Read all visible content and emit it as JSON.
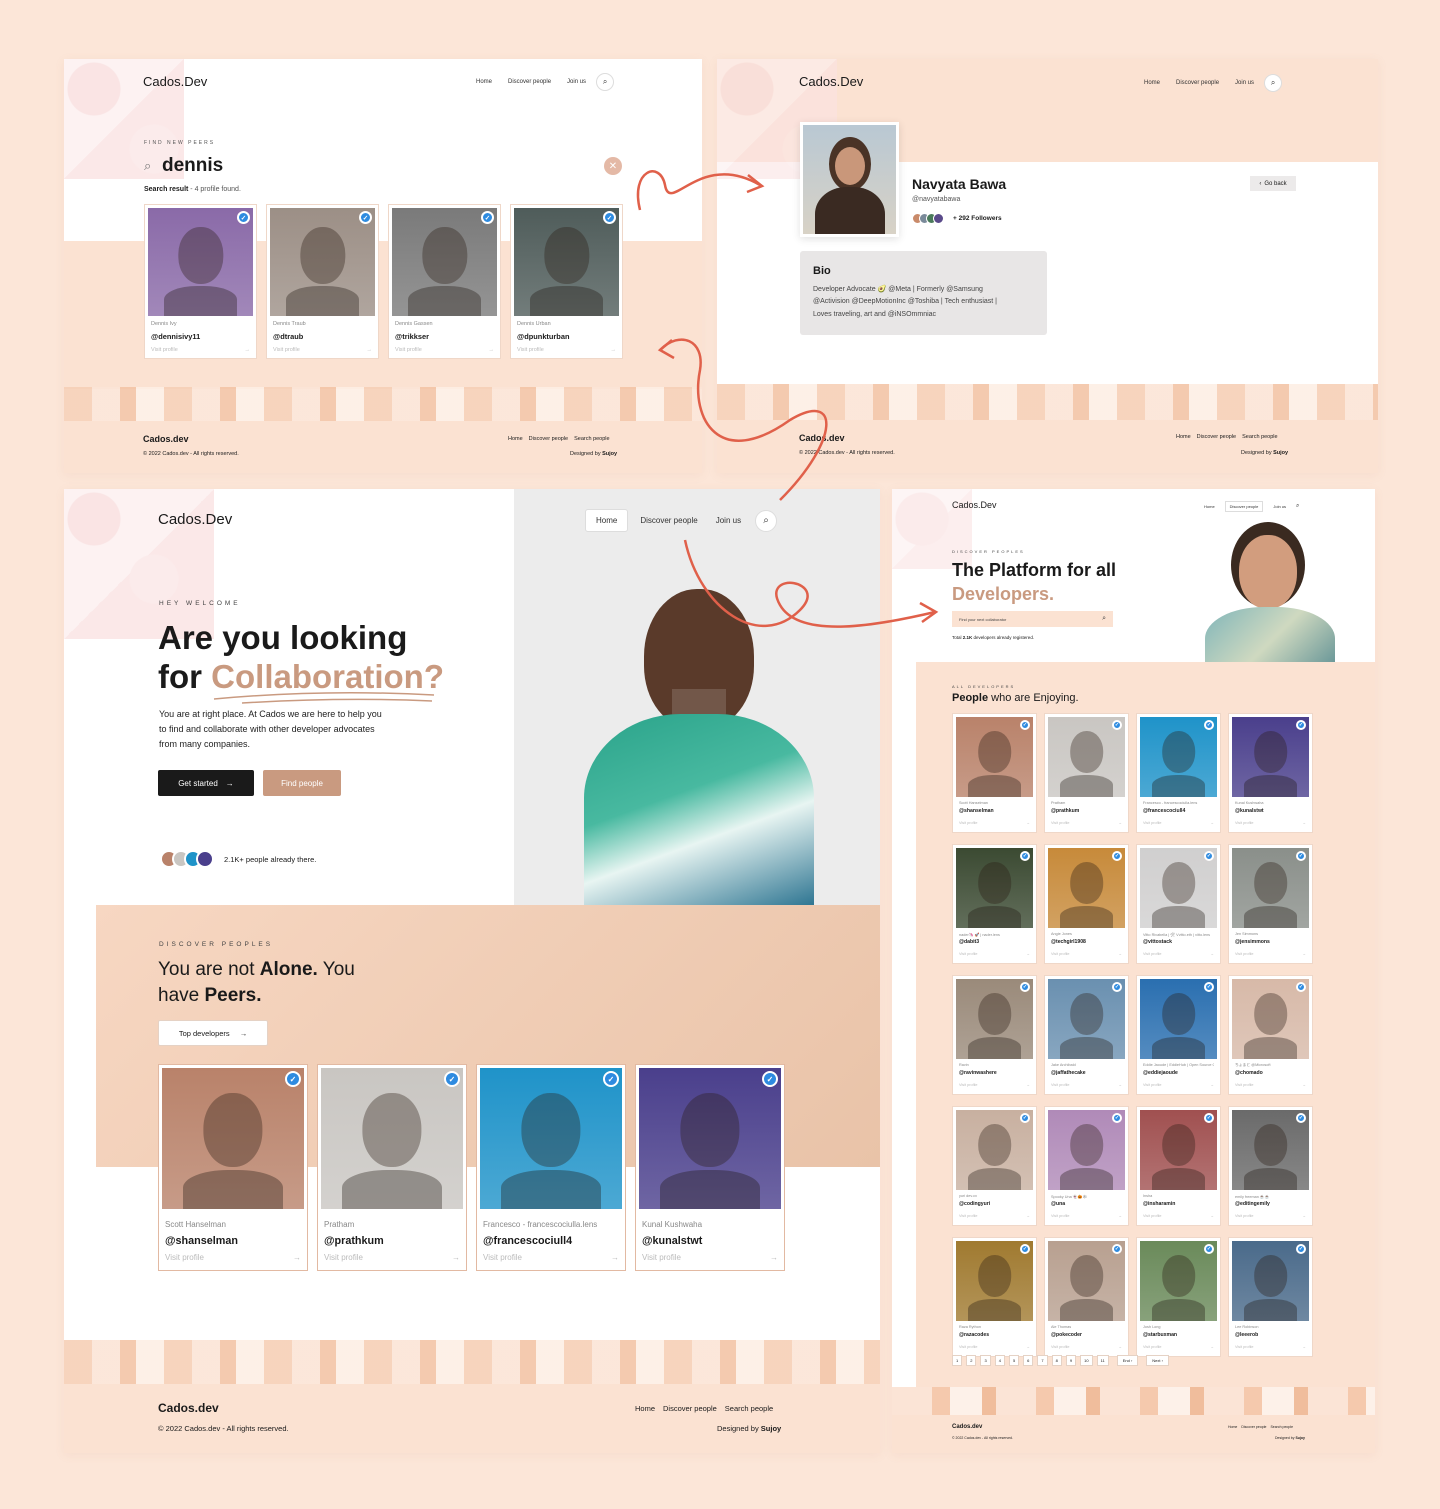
{
  "brand": "Cados.Dev",
  "footer_brand": "Cados.dev",
  "nav": {
    "home": "Home",
    "discover": "Discover people",
    "join": "Join us"
  },
  "footer": {
    "copyright": "© 2022 Cados.dev - All rights reserved.",
    "links": [
      "Home",
      "Discover people",
      "Search people"
    ],
    "designed_prefix": "Designed by",
    "designed_name": "Sujoy"
  },
  "search": {
    "eyebrow": "FIND NEW PEERS",
    "query": "dennis",
    "result_prefix": "Search result",
    "result_count": " - 4 profile found.",
    "cards": [
      {
        "name": "Dennis Ivy",
        "handle": "@dennisivy11",
        "visit": "Visit profile",
        "photo": "#8a6aa8"
      },
      {
        "name": "Dennis Traub",
        "handle": "@dtraub",
        "visit": "Visit profile",
        "photo": "#9c8f86"
      },
      {
        "name": "Dennis Gassen",
        "handle": "@trikkser",
        "visit": "Visit profile",
        "photo": "#7a7a7a"
      },
      {
        "name": "Dennis Urban",
        "handle": "@dpunkturban",
        "visit": "Visit profile",
        "photo": "#4f5c5a"
      }
    ]
  },
  "profile": {
    "name": "Navyata Bawa",
    "handle": "@navyatabawa",
    "followers": "+ 292 Followers",
    "go_back": "Go back",
    "bio_title": "Bio",
    "bio_lines": [
      "Developer Advocate 🥑 @Meta | Formerly @Samsung",
      "@Activision @DeepMotionInc @Toshiba | Tech enthusiast |",
      "Loves traveling, art and @iNSOmmniac"
    ]
  },
  "home": {
    "eyebrow": "HEY WELCOME",
    "title_line1": "Are you looking",
    "title_for": "for",
    "title_accent": "Collaboration?",
    "paragraph_lines": [
      "You are at right place. At Cados we are here to help you",
      "to find and collaborate with other developer advocates",
      "from many companies."
    ],
    "get_started": "Get started",
    "find_people": "Find people",
    "people_count": "2.1K+ people already there.",
    "discover_eyebrow": "DISCOVER PEOPLES",
    "alone_part1": "You are not ",
    "alone_bold": "Alone.",
    "alone_part2": " You",
    "have": "have ",
    "peers": "Peers.",
    "top_devs": "Top developers",
    "cards": [
      {
        "name": "Scott Hanselman",
        "handle": "@shanselman",
        "visit": "Visit profile",
        "photo": "#b9826a"
      },
      {
        "name": "Pratham",
        "handle": "@prathkum",
        "visit": "Visit profile",
        "photo": "#c9c6c2"
      },
      {
        "name": "Francesco - francescociulla.lens",
        "handle": "@francescociull4",
        "visit": "Visit profile",
        "photo": "#1f93c9"
      },
      {
        "name": "Kunal Kushwaha",
        "handle": "@kunalstwt",
        "visit": "Visit profile",
        "photo": "#4a3f8c"
      }
    ]
  },
  "discover": {
    "eyebrow": "DISCOVER PEOPLES",
    "title1": "The Platform for all",
    "title2": "Developers.",
    "search_placeholder": "Find your next collaborator",
    "total_prefix": "Total ",
    "total_count": "2.1K",
    "total_suffix": " developers already registered.",
    "section_eyebrow": "ALL DEVELOPERS",
    "section_title_bold": "People",
    "section_title_rest": " who are Enjoying.",
    "cards": [
      {
        "name": "Scott Hanselman",
        "handle": "@shanselman",
        "visit": "Visit profile",
        "photo": "#b9826a"
      },
      {
        "name": "Pratham",
        "handle": "@prathkum",
        "visit": "Visit profile",
        "photo": "#c9c6c2"
      },
      {
        "name": "Francesco - francescociulla.lens",
        "handle": "@francescociull4",
        "visit": "Visit profile",
        "photo": "#1f93c9"
      },
      {
        "name": "Kunal Kushwaha",
        "handle": "@kunalstwt",
        "visit": "Visit profile",
        "photo": "#4a3f8c"
      },
      {
        "name": "nader🦄 🚀 | nader.lens",
        "handle": "@dabit3",
        "visit": "Visit profile",
        "photo": "#3b4a32"
      },
      {
        "name": "Angie Jones",
        "handle": "@techgirl1908",
        "visit": "Visit profile",
        "photo": "#c78a3a"
      },
      {
        "name": "Vitto Rivabella | 🛠 Vvitto.eth | vitto.lens",
        "handle": "@vittostack",
        "visit": "Visit profile",
        "photo": "#d0cfcf"
      },
      {
        "name": "Jen Simmons",
        "handle": "@jensimmons",
        "visit": "Visit profile",
        "photo": "#8a8f8a"
      },
      {
        "name": "Ravin",
        "handle": "@ravinwashere",
        "visit": "Visit profile",
        "photo": "#9a8a7a"
      },
      {
        "name": "Jake Archibald",
        "handle": "@jaffathecake",
        "visit": "Visit profile",
        "photo": "#6a90b0"
      },
      {
        "name": "Eddie Jaoude | EddieHub | Open Source GitHub Star",
        "handle": "@eddiejaoude",
        "visit": "Visit profile",
        "photo": "#2a6fb0"
      },
      {
        "name": "ちょまど @Microsoft",
        "handle": "@chomado",
        "visit": "Visit profile",
        "photo": "#d7b9a8"
      },
      {
        "name": "yuri dev.cx",
        "handle": "@codingyuri",
        "visit": "Visit profile",
        "photo": "#c8b0a0"
      },
      {
        "name": "Spooky Una 👻🎃🕸",
        "handle": "@una",
        "visit": "Visit profile",
        "photo": "#b08ab8"
      },
      {
        "name": "Insha",
        "handle": "@insharamin",
        "visit": "Visit profile",
        "photo": "#a05050"
      },
      {
        "name": "emily freeman ☕️☕️",
        "handle": "@editingemily",
        "visit": "Visit profile",
        "photo": "#6a6a6a"
      },
      {
        "name": "Raza Rython",
        "handle": "@razacodes",
        "visit": "Visit profile",
        "photo": "#a07a30"
      },
      {
        "name": "Ale Thomas",
        "handle": "@pokecoder",
        "visit": "Visit profile",
        "photo": "#b8a090"
      },
      {
        "name": "Josh Long",
        "handle": "@starbuxman",
        "visit": "Visit profile",
        "photo": "#6a8a5a"
      },
      {
        "name": "Lee Robinson",
        "handle": "@leeerob",
        "visit": "Visit profile",
        "photo": "#4a6a8a"
      }
    ],
    "pages": [
      "1",
      "2",
      "3",
      "4",
      "5",
      "6",
      "7",
      "8",
      "9",
      "10",
      "11"
    ],
    "end": "End ›",
    "next": "Next ›"
  },
  "colors": {
    "accent": "#c99a80",
    "dark": "#1a1a1a",
    "peach": "#fbe2d2",
    "twitter": "#2e8be0"
  }
}
